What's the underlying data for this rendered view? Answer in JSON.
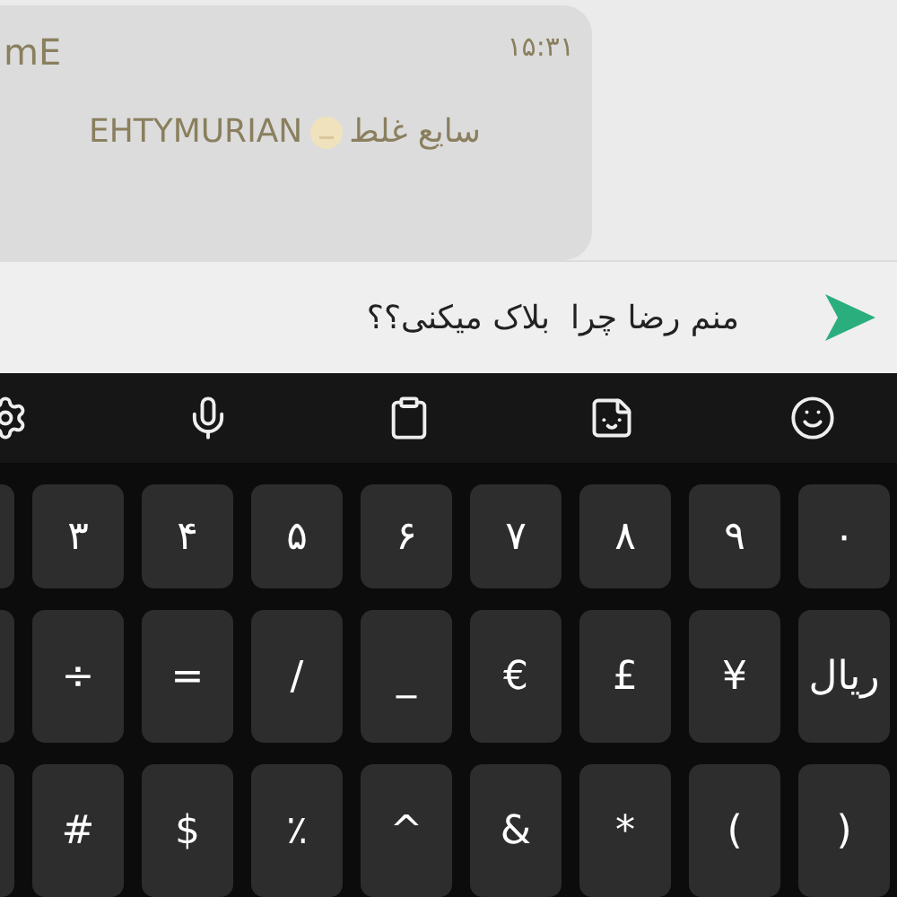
{
  "message": {
    "sender": "mE",
    "time": "۱۵:۳۱",
    "text_rtl": "سایع غلط",
    "text_ltr": "EHTYMURIAN"
  },
  "composer": {
    "value": "منم رضا چرا  بلاک میکنی؟؟"
  },
  "keyboard_toolbar": [
    {
      "kind": "settings"
    },
    {
      "kind": "mic"
    },
    {
      "kind": "clipboard"
    },
    {
      "kind": "sticker"
    },
    {
      "kind": "emoji"
    }
  ],
  "key_rows": [
    {
      "keys": [
        {
          "kind": "char",
          "label": "۰"
        },
        {
          "kind": "char",
          "label": "۹"
        },
        {
          "kind": "char",
          "label": "۸"
        },
        {
          "kind": "char",
          "label": "۷"
        },
        {
          "kind": "char",
          "label": "۶"
        },
        {
          "kind": "char",
          "label": "۵"
        },
        {
          "kind": "char",
          "label": "۴"
        },
        {
          "kind": "char",
          "label": "۳"
        },
        {
          "kind": "edge"
        }
      ]
    },
    {
      "keys": [
        {
          "kind": "char",
          "label": "ریال"
        },
        {
          "kind": "char",
          "label": "¥"
        },
        {
          "kind": "char",
          "label": "£"
        },
        {
          "kind": "char",
          "label": "€"
        },
        {
          "kind": "char",
          "label": "_"
        },
        {
          "kind": "char",
          "label": "/"
        },
        {
          "kind": "char",
          "label": "="
        },
        {
          "kind": "char",
          "label": "÷"
        },
        {
          "kind": "edge"
        }
      ]
    },
    {
      "keys": [
        {
          "kind": "char",
          "label": ")"
        },
        {
          "kind": "char",
          "label": "("
        },
        {
          "kind": "char",
          "label": "*"
        },
        {
          "kind": "char",
          "label": "&"
        },
        {
          "kind": "char",
          "label": "^"
        },
        {
          "kind": "char",
          "label": "٪"
        },
        {
          "kind": "char",
          "label": "$"
        },
        {
          "kind": "char",
          "label": "#"
        },
        {
          "kind": "edge"
        }
      ]
    }
  ]
}
